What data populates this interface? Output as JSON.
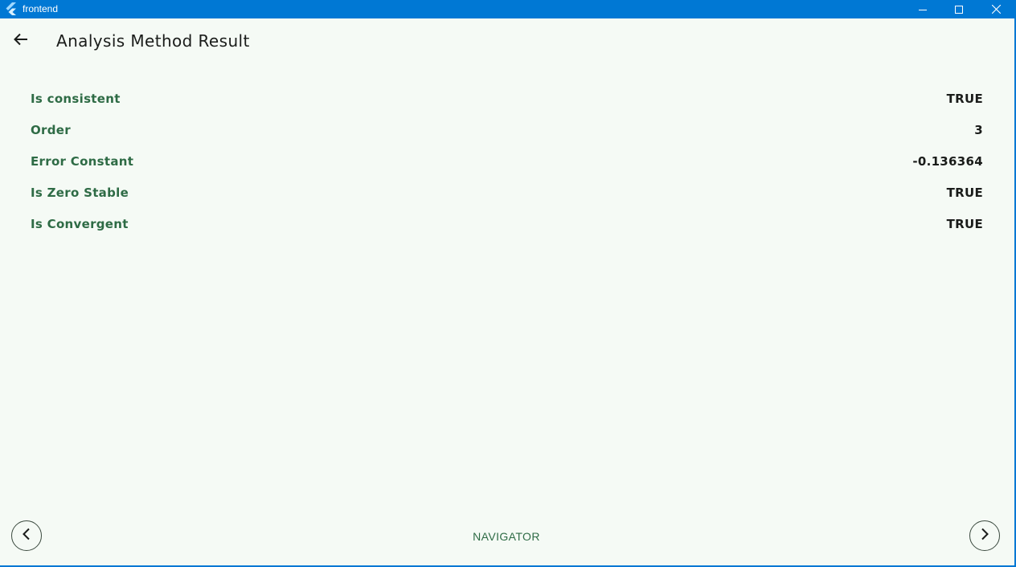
{
  "window": {
    "title": "frontend",
    "accent": "#0078d4",
    "icons": {
      "app": "flutter-icon",
      "minimize": "minimize-icon",
      "maximize": "maximize-icon",
      "close": "close-icon"
    }
  },
  "appbar": {
    "back_icon": "arrow-back-icon",
    "title": "Analysis Method Result"
  },
  "results": {
    "label_color": "#2e6b45",
    "rows": [
      {
        "label": "Is consistent",
        "value": "TRUE"
      },
      {
        "label": "Order",
        "value": "3"
      },
      {
        "label": "Error Constant",
        "value": "-0.136364"
      },
      {
        "label": "Is Zero Stable",
        "value": "TRUE"
      },
      {
        "label": "Is Convergent",
        "value": "TRUE"
      }
    ]
  },
  "navigator": {
    "label": "NAVIGATOR",
    "prev_icon": "chevron-left-icon",
    "next_icon": "chevron-right-icon"
  }
}
